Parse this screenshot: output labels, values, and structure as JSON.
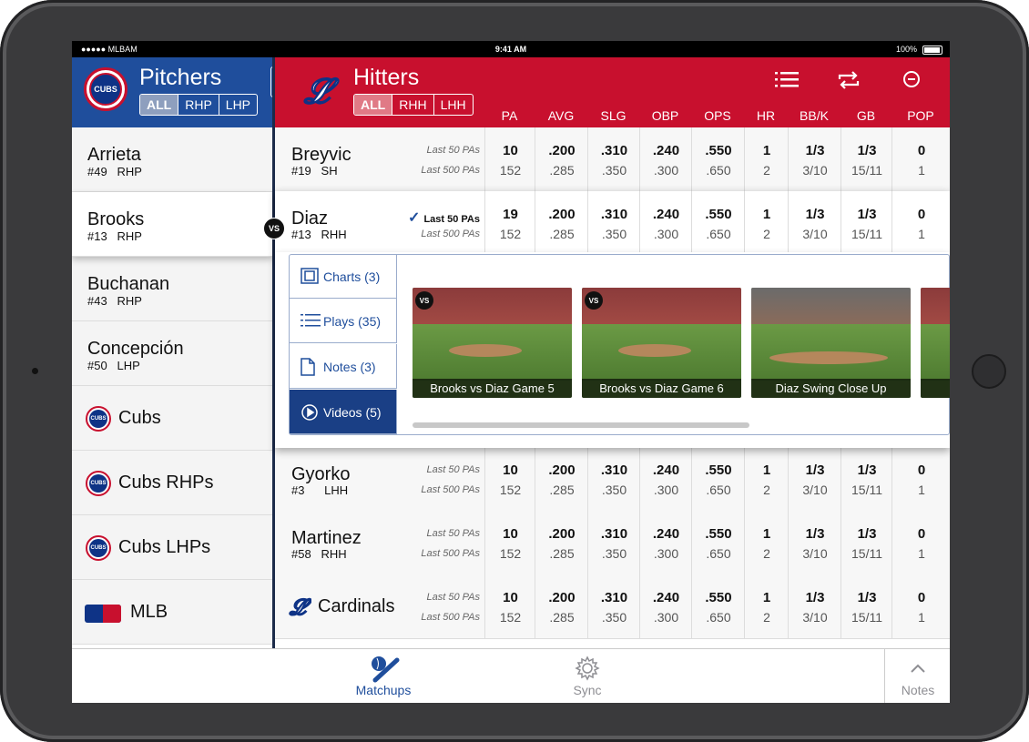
{
  "status": {
    "carrier": "●●●●● MLBAM",
    "time": "9:41 AM",
    "battery": "100%"
  },
  "left": {
    "title": "Pitchers",
    "filters": [
      "ALL",
      "RHP",
      "LHP"
    ],
    "pitchers": [
      {
        "name": "Arrieta",
        "sub": "#49   RHP"
      },
      {
        "name": "Brooks",
        "sub": "#13   RHP"
      },
      {
        "name": "Buchanan",
        "sub": "#43   RHP"
      },
      {
        "name": "Concepción",
        "sub": "#50   LHP"
      }
    ],
    "teams": [
      "Cubs",
      "Cubs RHPs",
      "Cubs LHPs",
      "MLB"
    ],
    "logo_text": "CUBS"
  },
  "vs_label": "VS",
  "right": {
    "title": "Hitters",
    "filters": [
      "ALL",
      "RHH",
      "LHH"
    ],
    "columns": [
      "PA",
      "AVG",
      "SLG",
      "OBP",
      "OPS",
      "HR",
      "BB/K",
      "GB",
      "POP"
    ],
    "range1": "Last 50 PAs",
    "range2": "Last 500 PAs",
    "checkmark": "✓",
    "rows": [
      {
        "name": "Breyvic",
        "sub": "#19   SH",
        "a": [
          "10",
          ".200",
          ".310",
          ".240",
          ".550",
          "1",
          "1/3",
          "1/3",
          "0"
        ],
        "b": [
          "152",
          ".285",
          ".350",
          ".300",
          ".650",
          "2",
          "3/10",
          "15/11",
          "1"
        ]
      },
      {
        "name": "Diaz",
        "sub": "#13   RHH",
        "a": [
          "19",
          ".200",
          ".310",
          ".240",
          ".550",
          "1",
          "1/3",
          "1/3",
          "0"
        ],
        "b": [
          "152",
          ".285",
          ".350",
          ".300",
          ".650",
          "2",
          "3/10",
          "15/11",
          "1"
        ]
      },
      {
        "name": "Gyorko",
        "sub": "#3      LHH",
        "a": [
          "10",
          ".200",
          ".310",
          ".240",
          ".550",
          "1",
          "1/3",
          "1/3",
          "0"
        ],
        "b": [
          "152",
          ".285",
          ".350",
          ".300",
          ".650",
          "2",
          "3/10",
          "15/11",
          "1"
        ]
      },
      {
        "name": "Martinez",
        "sub": "#58   RHH",
        "a": [
          "10",
          ".200",
          ".310",
          ".240",
          ".550",
          "1",
          "1/3",
          "1/3",
          "0"
        ],
        "b": [
          "152",
          ".285",
          ".350",
          ".300",
          ".650",
          "2",
          "3/10",
          "15/11",
          "1"
        ]
      },
      {
        "name": "Cardinals",
        "sub": "",
        "a": [
          "10",
          ".200",
          ".310",
          ".240",
          ".550",
          "1",
          "1/3",
          "1/3",
          "0"
        ],
        "b": [
          "152",
          ".285",
          ".350",
          ".300",
          ".650",
          "2",
          "3/10",
          "15/11",
          "1"
        ]
      }
    ]
  },
  "detail": {
    "tabs": [
      "Charts (3)",
      "Plays (35)",
      "Notes (3)",
      "Videos (5)"
    ],
    "videos": [
      {
        "title": "Brooks vs Diaz Game 5",
        "vs": "VS"
      },
      {
        "title": "Brooks vs Diaz Game 6",
        "vs": "VS"
      },
      {
        "title": "Diaz Swing Close Up",
        "vs": ""
      }
    ]
  },
  "tabbar": {
    "matchups": "Matchups",
    "sync": "Sync",
    "notes": "Notes"
  },
  "colors": {
    "cubs_blue": "#1f4e9c",
    "cardinals_red": "#c8102e",
    "active_tab": "#1a3f85"
  }
}
